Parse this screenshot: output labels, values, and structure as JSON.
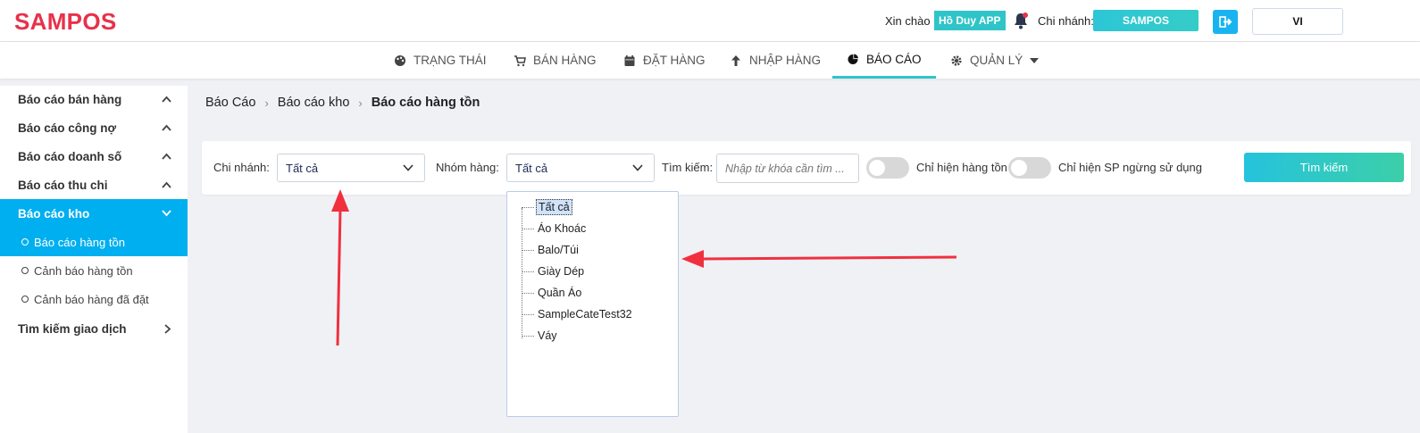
{
  "header": {
    "logo": "SAMPOS",
    "greeting": "Xin chào",
    "user": "Hồ Duy APP",
    "branch_label": "Chi nhánh:",
    "branch": "SAMPOS",
    "language": "VI"
  },
  "nav": {
    "items": [
      {
        "label": "TRẠNG THÁI",
        "icon": "palette-icon"
      },
      {
        "label": "BÁN HÀNG",
        "icon": "cart-icon"
      },
      {
        "label": "ĐẶT HÀNG",
        "icon": "calendar-icon"
      },
      {
        "label": "NHẬP HÀNG",
        "icon": "arrow-up-icon"
      },
      {
        "label": "BÁO CÁO",
        "icon": "pie-chart-icon",
        "active": true
      },
      {
        "label": "QUẢN LÝ",
        "icon": "gear-icon"
      }
    ]
  },
  "sidebar": {
    "items": [
      {
        "label": "Báo cáo bán hàng"
      },
      {
        "label": "Báo cáo công nợ"
      },
      {
        "label": "Báo cáo doanh số"
      },
      {
        "label": "Báo cáo thu chi"
      },
      {
        "label": "Báo cáo kho",
        "active": true
      }
    ],
    "sub_items": [
      {
        "label": "Báo cáo hàng tồn",
        "active": true
      },
      {
        "label": "Cảnh báo hàng tồn"
      },
      {
        "label": "Cảnh báo hàng đã đặt"
      }
    ],
    "last_item": "Tìm kiếm giao dịch"
  },
  "breadcrumb": [
    "Báo Cáo",
    "Báo cáo kho",
    "Báo cáo hàng tồn"
  ],
  "filter": {
    "branch_label": "Chi nhánh:",
    "branch_value": "Tất cả",
    "group_label": "Nhóm hàng:",
    "group_value": "Tất cả",
    "search_label": "Tìm kiếm:",
    "search_placeholder": "Nhập từ khóa cần tìm ...",
    "toggle1_label": "Chỉ hiện hàng tồn",
    "toggle2_label": "Chỉ hiện SP ngừng sử dụng",
    "search_button": "Tìm kiếm"
  },
  "tree": [
    "Tất cả",
    "Áo Khoác",
    "Balo/Túi",
    "Giày Dép",
    "Quần Áo",
    "SampleCateTest32",
    "Váy"
  ],
  "colors": {
    "brand": "#e8314a",
    "accent": "#00aff0",
    "teal": "#2fc5c8",
    "arrow": "#f0303f"
  }
}
